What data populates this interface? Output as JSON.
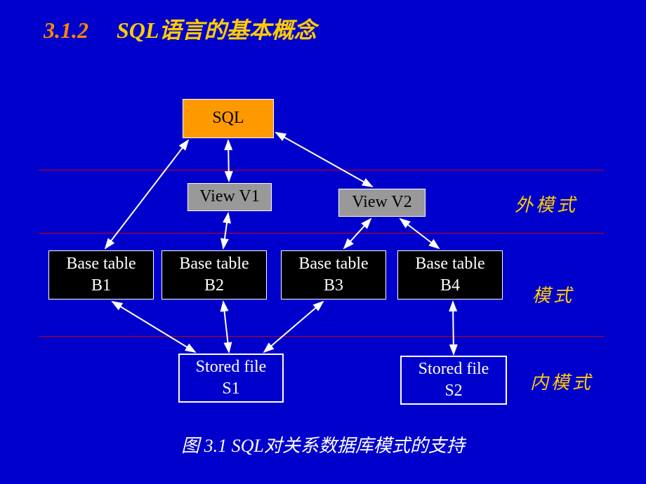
{
  "title": {
    "number": "3.1.2",
    "text": "SQL语言的基本概念"
  },
  "nodes": {
    "sql": "SQL",
    "view1": "View V1",
    "view2": "View V2",
    "bt1_l1": "Base  table",
    "bt1_l2": "B1",
    "bt2_l1": "Base  table",
    "bt2_l2": "B2",
    "bt3_l1": "Base  table",
    "bt3_l2": "B3",
    "bt4_l1": "Base  table",
    "bt4_l2": "B4",
    "sf1_l1": "Stored  file",
    "sf1_l2": "S1",
    "sf2_l1": "Stored  file",
    "sf2_l2": "S2"
  },
  "labels": {
    "external": "外模式",
    "schema": "模式",
    "internal": "内模式"
  },
  "caption": "图 3.1 SQL对关系数据库模式的支持"
}
